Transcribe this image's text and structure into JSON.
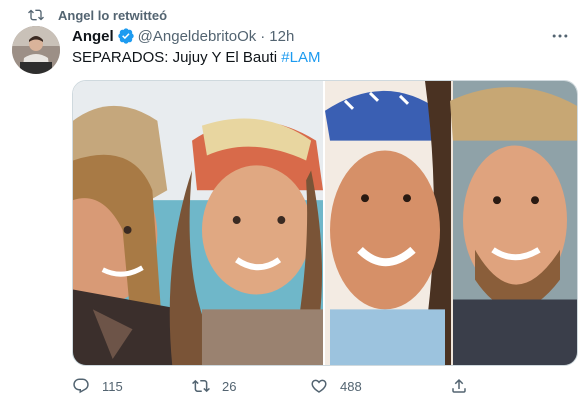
{
  "retweet_banner": {
    "text": "Angel lo retwitteó",
    "icon": "retweet-icon"
  },
  "author": {
    "name": "Angel",
    "handle": "@AngeldebritoOk",
    "separator": "·",
    "time": "12h",
    "verified": true
  },
  "tweet": {
    "text": "SEPARADOS: Jujuy Y El Bauti ",
    "hashtag": "#LAM"
  },
  "actions": {
    "reply": {
      "icon": "reply-icon",
      "count": "115"
    },
    "retweet": {
      "icon": "retweet-icon",
      "count": "26"
    },
    "like": {
      "icon": "heart-icon",
      "count": "488"
    },
    "share": {
      "icon": "share-icon"
    }
  },
  "colors": {
    "accent": "#1d9bf0",
    "secondary_text": "#536471",
    "primary_text": "#0f1419"
  }
}
